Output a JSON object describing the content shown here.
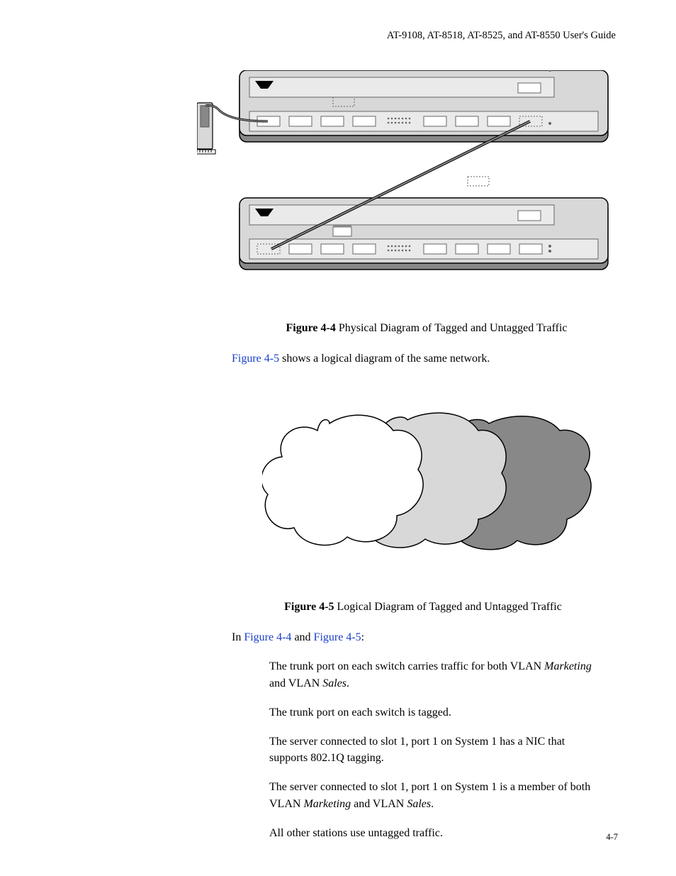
{
  "header": "AT-9108, AT-8518, AT-8525, and AT-8550  User's Guide",
  "figure44": {
    "label": "Figure 4-4",
    "caption": "  Physical Diagram of Tagged and Untagged Traffic"
  },
  "intro_line": {
    "link": "Figure 4-5",
    "rest": " shows a logical diagram of the same network."
  },
  "figure45": {
    "label": "Figure 4-5",
    "caption": "  Logical Diagram of Tagged and Untagged Traffic"
  },
  "in_line": {
    "prefix": "In ",
    "link1": "Figure 4-4",
    "mid": " and ",
    "link2": "Figure 4-5",
    "suffix": ":"
  },
  "bullets": {
    "b1a": "The trunk port on each switch carries traffic for both VLAN ",
    "b1_italic1": "Marketing",
    "b1b": " and VLAN ",
    "b1_italic2": "Sales",
    "b1c": ".",
    "b2": "The trunk port on each switch is tagged.",
    "b3": "The server connected to slot 1, port 1 on System 1 has a NIC that supports 802.1Q tagging.",
    "b4a": "The server connected to slot 1, port 1 on System 1 is a member of both VLAN ",
    "b4_italic1": "Marketing",
    "b4b": " and VLAN ",
    "b4_italic2": "Sales",
    "b4c": ".",
    "b5": "All other stations use untagged traffic."
  },
  "pagenum": "4-7"
}
